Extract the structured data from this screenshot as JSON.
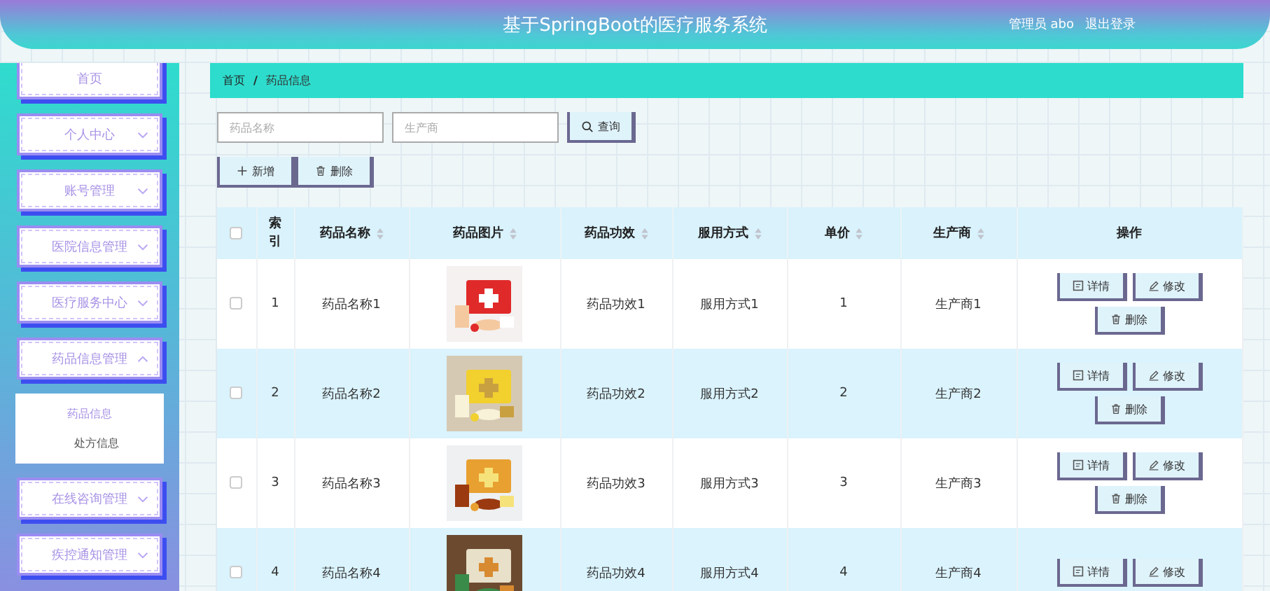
{
  "header": {
    "title": "基于SpringBoot的医疗服务系统",
    "user": "管理员 abo",
    "logout": "退出登录"
  },
  "sidebar": {
    "items": [
      {
        "kind": "link",
        "label": "首页"
      },
      {
        "kind": "menu",
        "label": "个人中心",
        "expanded": false
      },
      {
        "kind": "menu",
        "label": "账号管理",
        "expanded": false
      },
      {
        "kind": "menu",
        "label": "医院信息管理",
        "expanded": false
      },
      {
        "kind": "menu",
        "label": "医疗服务中心",
        "expanded": false
      },
      {
        "kind": "menu",
        "label": "药品信息管理",
        "expanded": true,
        "children": [
          {
            "label": "药品信息",
            "selected": true
          },
          {
            "label": "处方信息",
            "selected": false
          }
        ]
      },
      {
        "kind": "menu",
        "label": "在线咨询管理",
        "expanded": false
      },
      {
        "kind": "menu",
        "label": "疾控通知管理",
        "expanded": false
      }
    ]
  },
  "breadcrumb": {
    "items": [
      "首页",
      "药品信息"
    ],
    "separator": "/"
  },
  "search": {
    "fields": [
      {
        "placeholder": "药品名称"
      },
      {
        "placeholder": "生产商"
      }
    ],
    "button": "查询"
  },
  "toolbar": [
    {
      "kind": "add",
      "label": "新增"
    },
    {
      "kind": "delete",
      "label": "删除"
    }
  ],
  "table": {
    "columns": [
      {
        "kind": "check",
        "checked": false
      },
      {
        "kind": "text",
        "label": "索引",
        "sortable": false
      },
      {
        "kind": "text",
        "label": "药品名称",
        "sortable": true
      },
      {
        "kind": "text",
        "label": "药品图片",
        "sortable": true
      },
      {
        "kind": "text",
        "label": "药品功效",
        "sortable": true
      },
      {
        "kind": "text",
        "label": "服用方式",
        "sortable": true
      },
      {
        "kind": "text",
        "label": "单价",
        "sortable": true
      },
      {
        "kind": "text",
        "label": "生产商",
        "sortable": true
      },
      {
        "kind": "text",
        "label": "操作",
        "sortable": false
      }
    ],
    "rows": [
      {
        "checked": false,
        "index": "1",
        "name": "药品名称1",
        "picture": {
          "kind": "picture"
        },
        "effect": "药品功效1",
        "method": "服用方式1",
        "price": "1",
        "maker": "生产商1",
        "actions": [
          {
            "kind": "detail",
            "label": "详情"
          },
          {
            "kind": "edit",
            "label": "修改"
          },
          {
            "kind": "delete",
            "label": "删除"
          }
        ]
      },
      {
        "checked": false,
        "index": "2",
        "name": "药品名称2",
        "picture": {
          "kind": "picture"
        },
        "effect": "药品功效2",
        "method": "服用方式2",
        "price": "2",
        "maker": "生产商2",
        "actions": [
          {
            "kind": "detail",
            "label": "详情"
          },
          {
            "kind": "edit",
            "label": "修改"
          },
          {
            "kind": "delete",
            "label": "删除"
          }
        ]
      },
      {
        "checked": false,
        "index": "3",
        "name": "药品名称3",
        "picture": {
          "kind": "picture"
        },
        "effect": "药品功效3",
        "method": "服用方式3",
        "price": "3",
        "maker": "生产商3",
        "actions": [
          {
            "kind": "detail",
            "label": "详情"
          },
          {
            "kind": "edit",
            "label": "修改"
          },
          {
            "kind": "delete",
            "label": "删除"
          }
        ]
      },
      {
        "checked": false,
        "index": "4",
        "name": "药品名称4",
        "picture": {
          "kind": "picture"
        },
        "effect": "药品功效4",
        "method": "服用方式4",
        "price": "4",
        "maker": "生产商4",
        "actions": [
          {
            "kind": "detail",
            "label": "详情"
          },
          {
            "kind": "edit",
            "label": "修改"
          }
        ]
      }
    ]
  }
}
